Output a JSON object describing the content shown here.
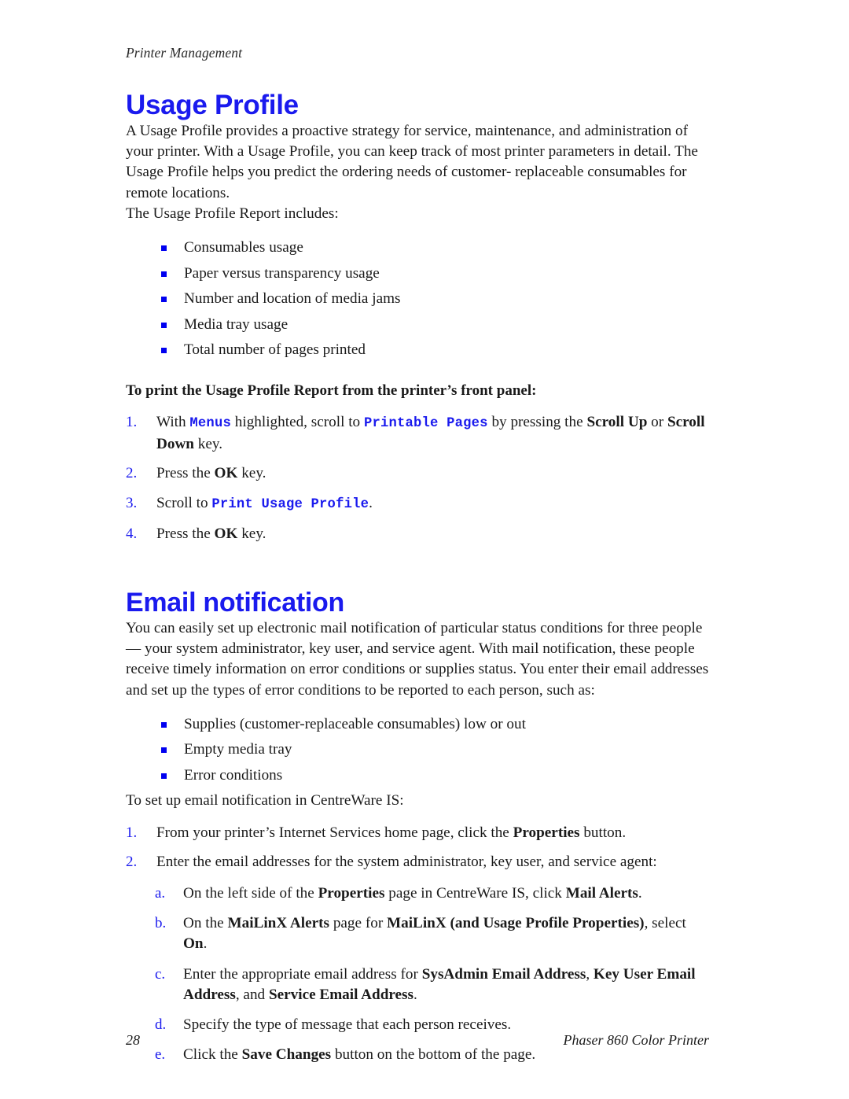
{
  "document": {
    "running_header": "Printer Management",
    "footer_page_number": "28",
    "footer_title": "Phaser 860 Color Printer",
    "accent_color": "#1a1aee",
    "bullet_color": "#0000f0",
    "background_color": "#ffffff"
  },
  "sections": {
    "usage_profile": {
      "heading": "Usage Profile",
      "intro_paragraph": "A Usage Profile provides a proactive strategy for service, maintenance, and administration of your printer. With a Usage Profile, you can keep track of most printer parameters in detail. The Usage Profile helps you predict the ordering needs of customer- replaceable consumables for remote locations.",
      "list_lead": "The Usage Profile Report includes:",
      "report_items": [
        "Consumables usage",
        "Paper versus transparency usage",
        "Number and location of media jams",
        "Media tray usage",
        "Total number of pages printed"
      ],
      "procedure_lead": "To print the Usage Profile Report from the printer’s front panel:",
      "steps": [
        {
          "marker": "1.",
          "runs": [
            {
              "text": "With ",
              "style": "plain"
            },
            {
              "text": "Menus",
              "style": "code"
            },
            {
              "text": " highlighted, scroll to ",
              "style": "plain"
            },
            {
              "text": "Printable Pages",
              "style": "code"
            },
            {
              "text": " by pressing the ",
              "style": "plain"
            },
            {
              "text": "Scroll Up",
              "style": "bold"
            },
            {
              "text": " or ",
              "style": "plain"
            },
            {
              "text": "Scroll Down",
              "style": "bold"
            },
            {
              "text": " key.",
              "style": "plain"
            }
          ]
        },
        {
          "marker": "2.",
          "runs": [
            {
              "text": "Press the ",
              "style": "plain"
            },
            {
              "text": "OK",
              "style": "bold"
            },
            {
              "text": " key.",
              "style": "plain"
            }
          ]
        },
        {
          "marker": "3.",
          "runs": [
            {
              "text": "Scroll to ",
              "style": "plain"
            },
            {
              "text": "Print Usage Profile",
              "style": "code"
            },
            {
              "text": ".",
              "style": "plain"
            }
          ]
        },
        {
          "marker": "4.",
          "runs": [
            {
              "text": "Press the ",
              "style": "plain"
            },
            {
              "text": "OK",
              "style": "bold"
            },
            {
              "text": " key.",
              "style": "plain"
            }
          ]
        }
      ]
    },
    "email_notification": {
      "heading": "Email notification",
      "intro_paragraph": "You can easily set up electronic mail notification of particular status conditions for three people — your system administrator, key user, and service agent. With mail notification, these people receive timely information on error conditions or supplies status. You enter their email addresses and set up the types of error conditions to be reported to each person, such as:",
      "condition_items": [
        "Supplies (customer-replaceable consumables) low or out",
        "Empty media tray",
        "Error conditions"
      ],
      "procedure_lead": "To set up email notification in CentreWare IS:",
      "steps": [
        {
          "marker": "1.",
          "runs": [
            {
              "text": "From your printer’s Internet Services home page, click the ",
              "style": "plain"
            },
            {
              "text": "Properties",
              "style": "bold"
            },
            {
              "text": " button.",
              "style": "plain"
            }
          ]
        },
        {
          "marker": "2.",
          "runs": [
            {
              "text": "Enter the email addresses for the system administrator, key user, and service agent:",
              "style": "plain"
            }
          ]
        }
      ],
      "substeps": [
        {
          "marker": "a.",
          "runs": [
            {
              "text": "On the left side of the ",
              "style": "plain"
            },
            {
              "text": "Properties",
              "style": "bold"
            },
            {
              "text": " page in CentreWare IS, click ",
              "style": "plain"
            },
            {
              "text": "Mail Alerts",
              "style": "bold"
            },
            {
              "text": ".",
              "style": "plain"
            }
          ]
        },
        {
          "marker": "b.",
          "runs": [
            {
              "text": "On the ",
              "style": "plain"
            },
            {
              "text": "MaiLinX Alerts",
              "style": "bold"
            },
            {
              "text": " page for ",
              "style": "plain"
            },
            {
              "text": "MaiLinX (and Usage Profile Properties)",
              "style": "bold"
            },
            {
              "text": ", select ",
              "style": "plain"
            },
            {
              "text": "On",
              "style": "bold"
            },
            {
              "text": ".",
              "style": "plain"
            }
          ]
        },
        {
          "marker": "c.",
          "runs": [
            {
              "text": "Enter the appropriate email address for ",
              "style": "plain"
            },
            {
              "text": "SysAdmin Email Address",
              "style": "bold"
            },
            {
              "text": ", ",
              "style": "plain"
            },
            {
              "text": "Key User Email Address",
              "style": "bold"
            },
            {
              "text": ", and ",
              "style": "plain"
            },
            {
              "text": "Service Email Address",
              "style": "bold"
            },
            {
              "text": ".",
              "style": "plain"
            }
          ]
        },
        {
          "marker": "d.",
          "runs": [
            {
              "text": "Specify the type of message that each person receives.",
              "style": "plain"
            }
          ]
        },
        {
          "marker": "e.",
          "runs": [
            {
              "text": "Click the ",
              "style": "plain"
            },
            {
              "text": "Save Changes",
              "style": "bold"
            },
            {
              "text": " button on the bottom of the page.",
              "style": "plain"
            }
          ]
        }
      ]
    }
  }
}
